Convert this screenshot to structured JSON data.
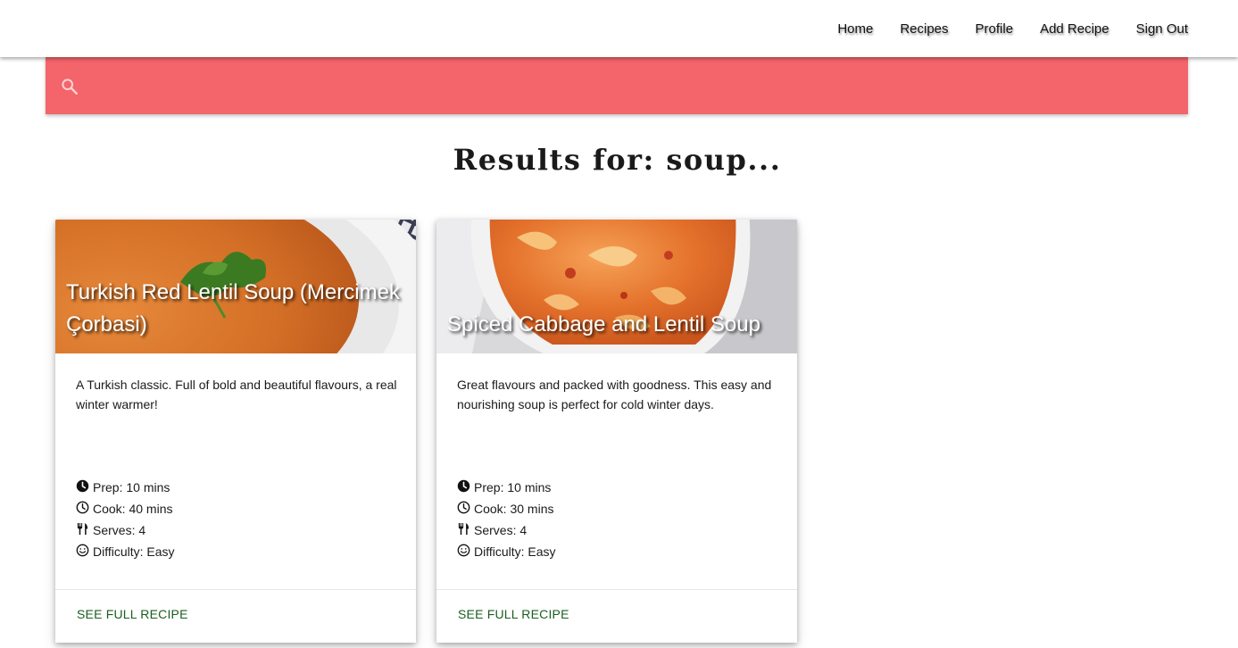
{
  "nav": {
    "links": [
      "Home",
      "Recipes",
      "Profile",
      "Add Recipe",
      "Sign Out"
    ]
  },
  "search": {
    "value": "",
    "icon": "search-icon",
    "background": "#f4646b"
  },
  "results": {
    "title": "Results for: soup..."
  },
  "cards": [
    {
      "title": "Turkish Red Lentil Soup (Mercimek Çorbasi)",
      "description": "A Turkish classic. Full of bold and beautiful flavours, a real winter warmer!",
      "prep": "Prep: 10 mins",
      "cook": "Cook: 40 mins",
      "serves": "Serves: 4",
      "difficulty": "Difficulty: Easy",
      "action": "SEE FULL RECIPE"
    },
    {
      "title": "Spiced Cabbage and Lentil Soup",
      "description": "Great flavours and packed with goodness. This easy and nourishing soup is perfect for cold winter days.",
      "prep": "Prep: 10 mins",
      "cook": "Cook: 30 mins",
      "serves": "Serves: 4",
      "difficulty": "Difficulty: Easy",
      "action": "SEE FULL RECIPE"
    }
  ],
  "colors": {
    "accent": "#f4646b",
    "action_link": "#1b5e20"
  }
}
